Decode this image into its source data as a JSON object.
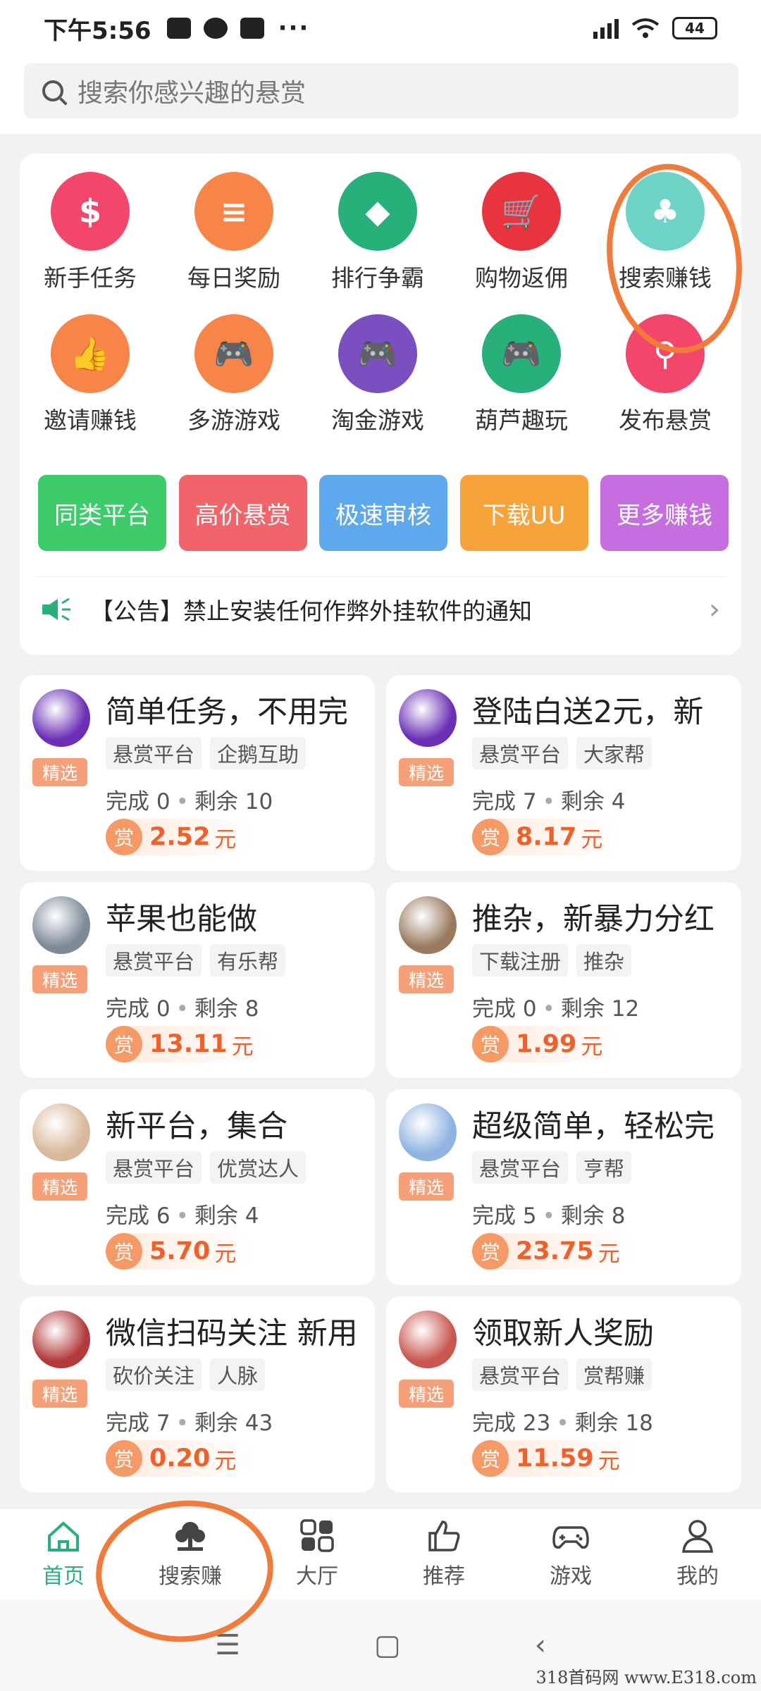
{
  "status_bar": {
    "time": "下午5:56",
    "battery": "44"
  },
  "search": {
    "placeholder": "搜索你感兴趣的悬赏"
  },
  "grid_items": [
    {
      "label": "新手任务",
      "color": "#f2466b",
      "icon": "money-bag-icon",
      "glyph": "$"
    },
    {
      "label": "每日奖励",
      "color": "#f7854a",
      "icon": "coins-icon",
      "glyph": "≡"
    },
    {
      "label": "排行争霸",
      "color": "#27b07a",
      "icon": "diamond-icon",
      "glyph": "◆"
    },
    {
      "label": "购物返佣",
      "color": "#e8343f",
      "icon": "cart-icon",
      "glyph": "🛒"
    },
    {
      "label": "搜索赚钱",
      "color": "#6dd3c6",
      "icon": "tree-icon",
      "glyph": "♣"
    },
    {
      "label": "邀请赚钱",
      "color": "#f7854a",
      "icon": "thumbs-up-icon",
      "glyph": "👍"
    },
    {
      "label": "多游游戏",
      "color": "#f7854a",
      "icon": "gamepad-icon",
      "glyph": "🎮"
    },
    {
      "label": "淘金游戏",
      "color": "#7a4fbf",
      "icon": "gamepad-icon",
      "glyph": "🎮"
    },
    {
      "label": "葫芦趣玩",
      "color": "#27b07a",
      "icon": "gamepad-icon",
      "glyph": "🎮"
    },
    {
      "label": "发布悬赏",
      "color": "#f2466b",
      "icon": "share-icon",
      "glyph": "⚲"
    }
  ],
  "pills": [
    {
      "label": "同类平台",
      "color": "#3ecb6a"
    },
    {
      "label": "高价悬赏",
      "color": "#f1646a"
    },
    {
      "label": "极速审核",
      "color": "#5ea8ee"
    },
    {
      "label": "下载UU",
      "color": "#f8a23a"
    },
    {
      "label": "更多赚钱",
      "color": "#c66ee0"
    }
  ],
  "notice": {
    "text": "【公告】禁止安装任何作弊外挂软件的通知"
  },
  "tasks": [
    {
      "title": "简单任务，不用完",
      "tags": [
        "悬赏平台",
        "企鹅互助"
      ],
      "done": "完成 0",
      "left": "剩余 10",
      "amount": "2.52",
      "avatar_color": "#6a2fb5",
      "badge": "精选"
    },
    {
      "title": "登陆白送2元，新",
      "tags": [
        "悬赏平台",
        "大家帮"
      ],
      "done": "完成 7",
      "left": "剩余 4",
      "amount": "8.17",
      "avatar_color": "#6a2fb5",
      "badge": "精选"
    },
    {
      "title": "苹果也能做",
      "tags": [
        "悬赏平台",
        "有乐帮"
      ],
      "done": "完成 0",
      "left": "剩余 8",
      "amount": "13.11",
      "avatar_color": "#7d8a98",
      "badge": "精选"
    },
    {
      "title": "推杂，新暴力分红",
      "tags": [
        "下载注册",
        "推杂"
      ],
      "done": "完成 0",
      "left": "剩余 12",
      "amount": "1.99",
      "avatar_color": "#9a7a5e",
      "badge": "精选"
    },
    {
      "title": "新平台，集合",
      "tags": [
        "悬赏平台",
        "优赏达人"
      ],
      "done": "完成 6",
      "left": "剩余 4",
      "amount": "5.70",
      "avatar_color": "#d8b89a",
      "badge": "精选"
    },
    {
      "title": "超级简单，轻松完",
      "tags": [
        "悬赏平台",
        "亨帮"
      ],
      "done": "完成 5",
      "left": "剩余 8",
      "amount": "23.75",
      "avatar_color": "#8fb4e0",
      "badge": "精选"
    },
    {
      "title": "微信扫码关注 新用",
      "tags": [
        "砍价关注",
        "人脉"
      ],
      "done": "完成 7",
      "left": "剩余 43",
      "amount": "0.20",
      "avatar_color": "#b23a3a",
      "badge": "精选"
    },
    {
      "title": "领取新人奖励",
      "tags": [
        "悬赏平台",
        "赏帮赚"
      ],
      "done": "完成 23",
      "left": "剩余 18",
      "amount": "11.59",
      "avatar_color": "#c9574f",
      "badge": "精选"
    }
  ],
  "reward": {
    "prefix": "赏",
    "unit": "元"
  },
  "nav": [
    {
      "label": "首页",
      "icon": "home-icon",
      "active": true
    },
    {
      "label": "搜索赚",
      "icon": "tree-icon",
      "active": false
    },
    {
      "label": "大厅",
      "icon": "grid-icon",
      "active": false
    },
    {
      "label": "推荐",
      "icon": "thumbs-up-icon",
      "active": false
    },
    {
      "label": "游戏",
      "icon": "gamepad-icon",
      "active": false
    },
    {
      "label": "我的",
      "icon": "user-icon",
      "active": false
    }
  ],
  "watermark": "318首码网 www.E318.com"
}
